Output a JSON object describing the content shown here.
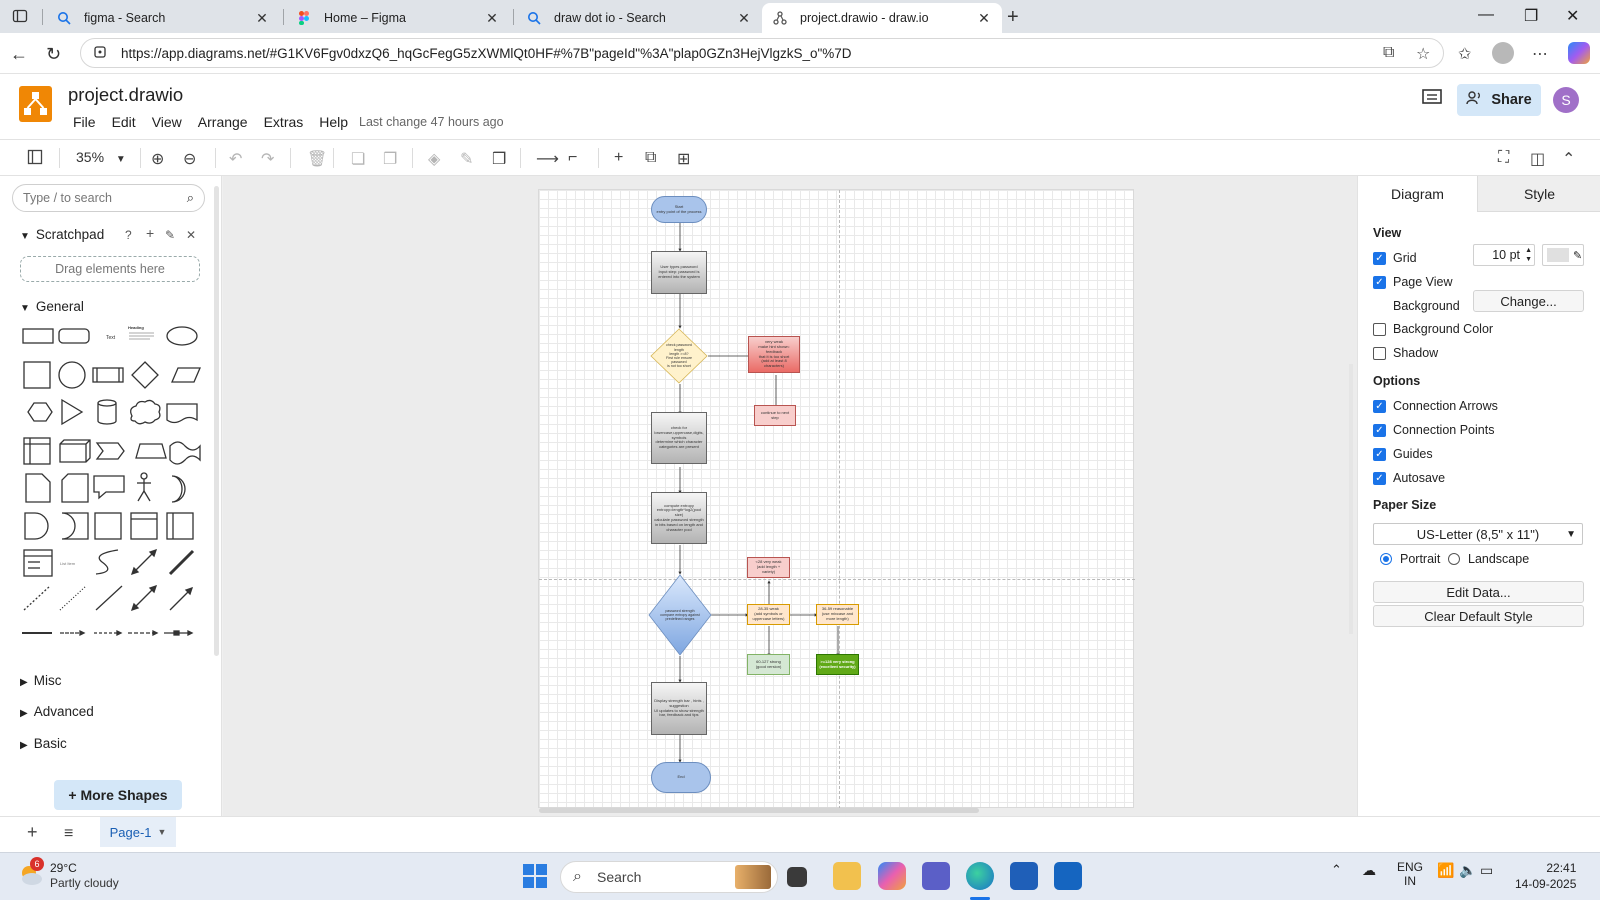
{
  "browser": {
    "tabs": [
      {
        "title": "figma - Search",
        "icon": "search-icon"
      },
      {
        "title": "Home – Figma",
        "icon": "figma-icon"
      },
      {
        "title": "draw dot io - Search",
        "icon": "search-icon"
      },
      {
        "title": "project.drawio - draw.io",
        "icon": "drawio-icon",
        "active": true
      }
    ],
    "url": "https://app.diagrams.net/#G1KV6Fgv0dxzQ6_hqGcFegG5zXWMlQt0HF#%7B\"pageId\"%3A\"plap0GZn3HejVlgzkS_o\"%7D"
  },
  "app": {
    "file_name": "project.drawio",
    "menus": [
      "File",
      "Edit",
      "View",
      "Arrange",
      "Extras",
      "Help"
    ],
    "last_change": "Last change 47 hours ago",
    "share_label": "Share",
    "avatar_initial": "S",
    "accent_color": "#f08705"
  },
  "toolbar": {
    "zoom": "35%"
  },
  "left_panel": {
    "search_placeholder": "Type / to search",
    "scratchpad_label": "Scratchpad",
    "dropzone_label": "Drag elements here",
    "general_label": "General",
    "misc_label": "Misc",
    "advanced_label": "Advanced",
    "basic_label": "Basic",
    "more_shapes_label": "+ More Shapes",
    "shape_text_label": "Text",
    "shape_heading_label": "Heading",
    "shape_list_label": "List Item"
  },
  "diagram": {
    "nodes": {
      "start": "Start\nentry point of the process",
      "input": "User types password\nInput step: password is\nentered into the system",
      "check_len": "check password\nlength\nlength >=8?\nFirst rule ensure\npassword\nis not too short",
      "very_weak": "very weak\nmake hint shown: feedback\nthat it is too short\n(add at least 8 characters)",
      "continue": "continue to next step",
      "check_chars": "check for\nlowercase,uppercase,digits,\nsymbols\ndetermine which character\ncategories are present",
      "entropy": "compute entropy\nentropy=length*log2(pool\nsize)\ncalculate password strength\nin bits based on length and\ncharacter pool",
      "strength": "password strength\ncompare entropy against\npredefined ranges",
      "weak": "<28 very weak\n(add length + variety)",
      "fair": "28-35 weak\n(add symbols or\nuppercase letters)",
      "moderate": "36-59 reasonable\n(use mixcase and\nmore length)",
      "strong": "60-127 strong\n(good version)",
      "very_strong": ">=128 very strong\n(excellent security)",
      "display": "Display strength bar , hints ,\nsuggestion\nUI updates to show strength\nbar, feedback and tips",
      "end": "End"
    }
  },
  "right_panel": {
    "tabs": [
      "Diagram",
      "Style"
    ],
    "view_label": "View",
    "grid_label": "Grid",
    "grid_size": "10 pt",
    "page_view_label": "Page View",
    "background_label": "Background",
    "change_label": "Change...",
    "bg_color_label": "Background Color",
    "shadow_label": "Shadow",
    "options_label": "Options",
    "conn_arrows_label": "Connection Arrows",
    "conn_points_label": "Connection Points",
    "guides_label": "Guides",
    "autosave_label": "Autosave",
    "paper_size_label": "Paper Size",
    "paper_size_value": "US-Letter (8,5\" x 11\")",
    "portrait_label": "Portrait",
    "landscape_label": "Landscape",
    "edit_data_label": "Edit Data...",
    "clear_style_label": "Clear Default Style",
    "checkbox_color": "#1a73e8"
  },
  "page_bar": {
    "page_name": "Page-1"
  },
  "taskbar": {
    "weather_badge": "6",
    "temperature": "29°C",
    "weather": "Partly cloudy",
    "search_label": "Search",
    "lang_top": "ENG",
    "lang_bottom": "IN",
    "time": "22:41",
    "date": "14-09-2025"
  }
}
